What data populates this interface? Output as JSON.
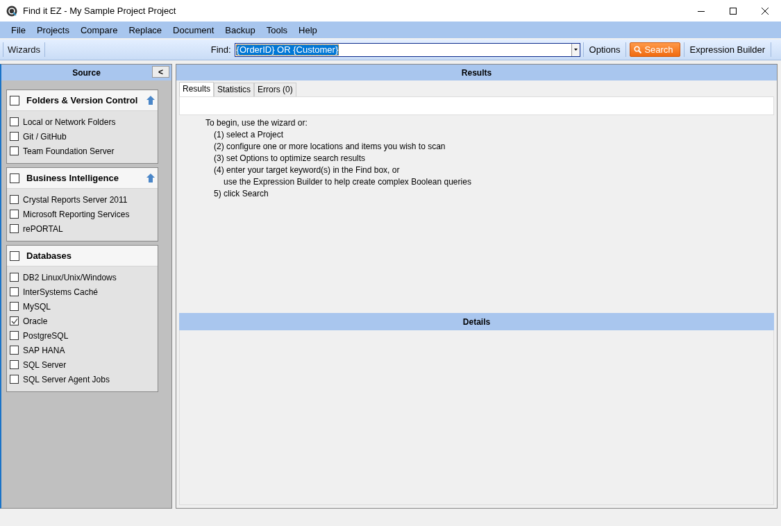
{
  "window": {
    "title": "Find it EZ - My Sample Project Project"
  },
  "menu": [
    "File",
    "Projects",
    "Compare",
    "Replace",
    "Document",
    "Backup",
    "Tools",
    "Help"
  ],
  "toolbar": {
    "wizards": "Wizards",
    "find_label": "Find:",
    "find_value": "{OrderID} OR {Customer}",
    "options": "Options",
    "search": "Search",
    "expression_builder": "Expression Builder"
  },
  "source": {
    "title": "Source",
    "collapse": "<",
    "groups": [
      {
        "title": "Folders & Version Control",
        "checked": false,
        "collapsible": true,
        "items": [
          {
            "label": "Local or Network Folders",
            "checked": false
          },
          {
            "label": "Git / GitHub",
            "checked": false
          },
          {
            "label": "Team Foundation Server",
            "checked": false
          }
        ]
      },
      {
        "title": "Business Intelligence",
        "checked": false,
        "collapsible": true,
        "items": [
          {
            "label": "Crystal Reports Server 2011",
            "checked": false
          },
          {
            "label": "Microsoft Reporting Services",
            "checked": false
          },
          {
            "label": "rePORTAL",
            "checked": false
          }
        ]
      },
      {
        "title": "Databases",
        "checked": false,
        "collapsible": false,
        "items": [
          {
            "label": "DB2 Linux/Unix/Windows",
            "checked": false
          },
          {
            "label": "InterSystems Caché",
            "checked": false
          },
          {
            "label": "MySQL",
            "checked": false
          },
          {
            "label": "Oracle",
            "checked": true
          },
          {
            "label": "PostgreSQL",
            "checked": false
          },
          {
            "label": "SAP HANA",
            "checked": false
          },
          {
            "label": "SQL Server",
            "checked": false
          },
          {
            "label": "SQL Server Agent Jobs",
            "checked": false
          }
        ]
      }
    ]
  },
  "results": {
    "title": "Results",
    "tabs": [
      {
        "label": "Results",
        "selected": true
      },
      {
        "label": "Statistics",
        "selected": false
      },
      {
        "label": "Errors (0)",
        "selected": false
      }
    ],
    "instructions": [
      {
        "kind": "intro",
        "text": "To begin, use the wizard or:"
      },
      {
        "kind": "step",
        "text": "(1) select a Project"
      },
      {
        "kind": "step",
        "text": "(2) configure one or more locations and items you wish to scan"
      },
      {
        "kind": "step",
        "text": "(3) set Options to optimize search results"
      },
      {
        "kind": "step",
        "text": "(4) enter your target keyword(s) in the Find box, or"
      },
      {
        "kind": "continuation",
        "text": "use the Expression Builder to help create complex Boolean queries"
      },
      {
        "kind": "step",
        "text": "5) click Search"
      }
    ]
  },
  "details": {
    "title": "Details"
  }
}
